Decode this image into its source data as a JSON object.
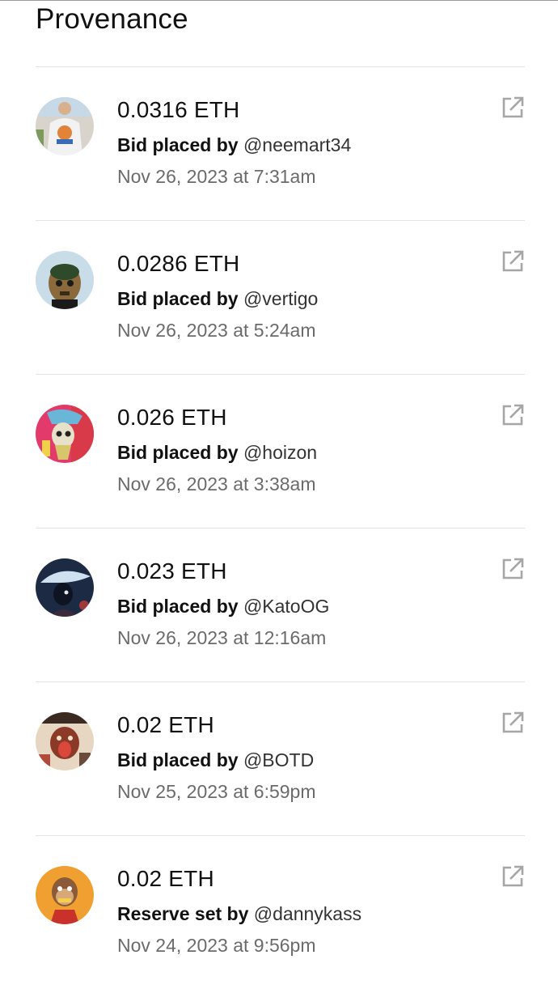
{
  "page": {
    "title": "Provenance"
  },
  "colors": {
    "text": "#111111",
    "muted": "#6b6b6b",
    "divider": "#e3e3e3",
    "icon": "#a6a6a6"
  },
  "events": [
    {
      "amount": "0.0316 ETH",
      "action": "Bid placed by",
      "user": "@neemart34",
      "time": "Nov 26, 2023 at 7:31am",
      "avatar": "avatar-neemart34",
      "icon": "external-link-icon"
    },
    {
      "amount": "0.0286 ETH",
      "action": "Bid placed by",
      "user": "@vertigo",
      "time": "Nov 26, 2023 at 5:24am",
      "avatar": "avatar-vertigo",
      "icon": "external-link-icon"
    },
    {
      "amount": "0.026 ETH",
      "action": "Bid placed by",
      "user": "@hoizon",
      "time": "Nov 26, 2023 at 3:38am",
      "avatar": "avatar-hoizon",
      "icon": "external-link-icon"
    },
    {
      "amount": "0.023 ETH",
      "action": "Bid placed by",
      "user": "@KatoOG",
      "time": "Nov 26, 2023 at 12:16am",
      "avatar": "avatar-katoog",
      "icon": "external-link-icon"
    },
    {
      "amount": "0.02 ETH",
      "action": "Bid placed by",
      "user": "@BOTD",
      "time": "Nov 25, 2023 at 6:59pm",
      "avatar": "avatar-botd",
      "icon": "external-link-icon"
    },
    {
      "amount": "0.02 ETH",
      "action": "Reserve set by",
      "user": "@dannykass",
      "time": "Nov 24, 2023 at 9:56pm",
      "avatar": "avatar-dannykass",
      "icon": "external-link-icon"
    }
  ]
}
